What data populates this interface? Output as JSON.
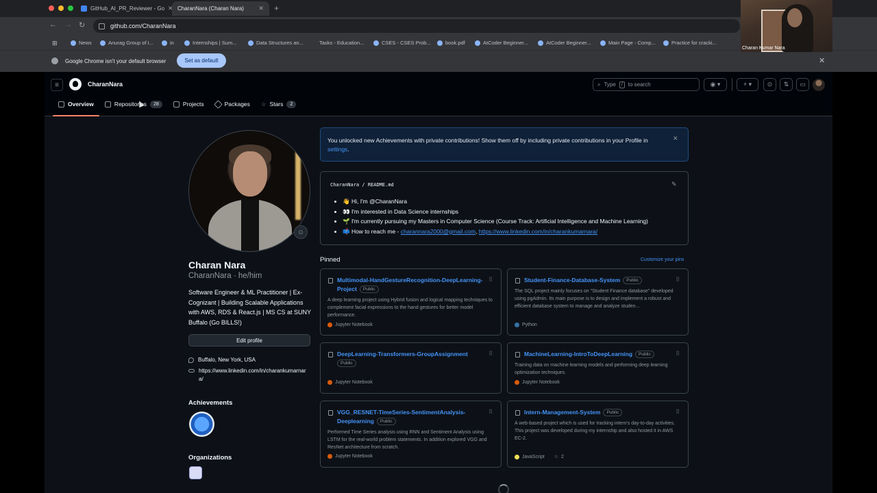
{
  "browser": {
    "tabs": [
      {
        "label": "GitHub_AI_PR_Reviewer - Go"
      },
      {
        "label": "CharanNara (Charan Nara)"
      }
    ],
    "url": "github.com/CharanNara",
    "bookmarks": [
      "News",
      "Anurag Group of I...",
      "in",
      "Internships | Sum...",
      "Data Structures an...",
      "Tasks - Education...",
      "CSES - CSES Prob...",
      "book.pdf",
      "AtCoder Beginner...",
      "AtCoder Beginner...",
      "Main Page - Comp...",
      "Practice for cracki..."
    ],
    "infobar_text": "Google Chrome isn't your default browser",
    "set_default_label": "Set as default",
    "webcam_label": "Charan Kumar Nara"
  },
  "header": {
    "username": "CharanNara",
    "search_prefix": "Type",
    "search_key": "/",
    "search_suffix": "to search"
  },
  "nav": {
    "overview": "Overview",
    "repositories": "Repositories",
    "repositories_count": "28",
    "projects": "Projects",
    "packages": "Packages",
    "stars": "Stars",
    "stars_count": "2"
  },
  "profile": {
    "name": "Charan Nara",
    "login": "CharanNara · he/him",
    "bio": "Software Engineer & ML Practitioner | Ex-Cognizant | Building Scalable Applications with AWS, RDS & React.js | MS CS at SUNY Buffalo (Go BILLS!)",
    "edit_label": "Edit profile",
    "location": "Buffalo, New York, USA",
    "website": "https://www.linkedin.com/in/charankumarnara/",
    "achievements_heading": "Achievements",
    "organizations_heading": "Organizations"
  },
  "banner": {
    "text": "You unlocked new Achievements with private contributions! Show them off by including private contributions in your Profile in",
    "link": "settings",
    "end": "."
  },
  "readme": {
    "owner": "CharanNara",
    "file": "README.md",
    "items": [
      {
        "text": "👋 Hi, I'm @CharanNara"
      },
      {
        "text": "👀 I'm interested in Data Science internships"
      },
      {
        "text": "🌱 I'm currently pursuing my Masters in Computer Science (Course Track: Artificial Intelligence and Machine Learning)"
      }
    ],
    "reach_prefix": "📫 How to reach me - ",
    "email": "charannara2000@gmail.com",
    "linkedin": "https://www.linkedin.com/in/charankumarnara/"
  },
  "pinned": {
    "heading": "Pinned",
    "customize": "Customize your pins",
    "public_label": "Public",
    "cards": [
      {
        "title": "Multimodal-HandGestureRecognition-DeepLearning-Project",
        "desc": "A deep learning project using Hybrid fusion and logical mapping techniques to complement facial expressions to the hand gestures for better model performance.",
        "lang": "Jupyter Notebook",
        "lang_color": "#DA5B0B"
      },
      {
        "title": "Student-Finance-Database-System",
        "desc": "The SQL project mainly focuses on \"Student Finance database\" developed using pgAdmin. Its main purpose is to design and implement a robust and efficient database system to manage and analyze studen...",
        "lang": "Python",
        "lang_color": "#3572A5"
      },
      {
        "title": "DeepLearning-Transformers-GroupAssignment",
        "desc": "",
        "lang": "Jupyter Notebook",
        "lang_color": "#DA5B0B"
      },
      {
        "title": "MachineLearning-IntroToDeepLearning",
        "desc": "Training data on machine learning models and performing deep learning optimization techniques.",
        "lang": "Jupyter Notebook",
        "lang_color": "#DA5B0B"
      },
      {
        "title": "VGG_RESNET-TimeSeries-SentimentAnalysis-Deeplearning",
        "desc": "Performed Time Series analysis using RNN and Sentiment Analysis using LSTM for the real-world problem statements. In addition explored VGG and ResNet architecture from scratch.",
        "lang": "Jupyter Notebook",
        "lang_color": "#DA5B0B"
      },
      {
        "title": "Intern-Management-System",
        "desc": "A web-based project which is used for tracking intern's day-to-day activities. This project was developed during my internship and also hosted it in AWS EC-2.",
        "lang": "JavaScript",
        "lang_color": "#f1e05a",
        "stars": "2"
      }
    ]
  }
}
